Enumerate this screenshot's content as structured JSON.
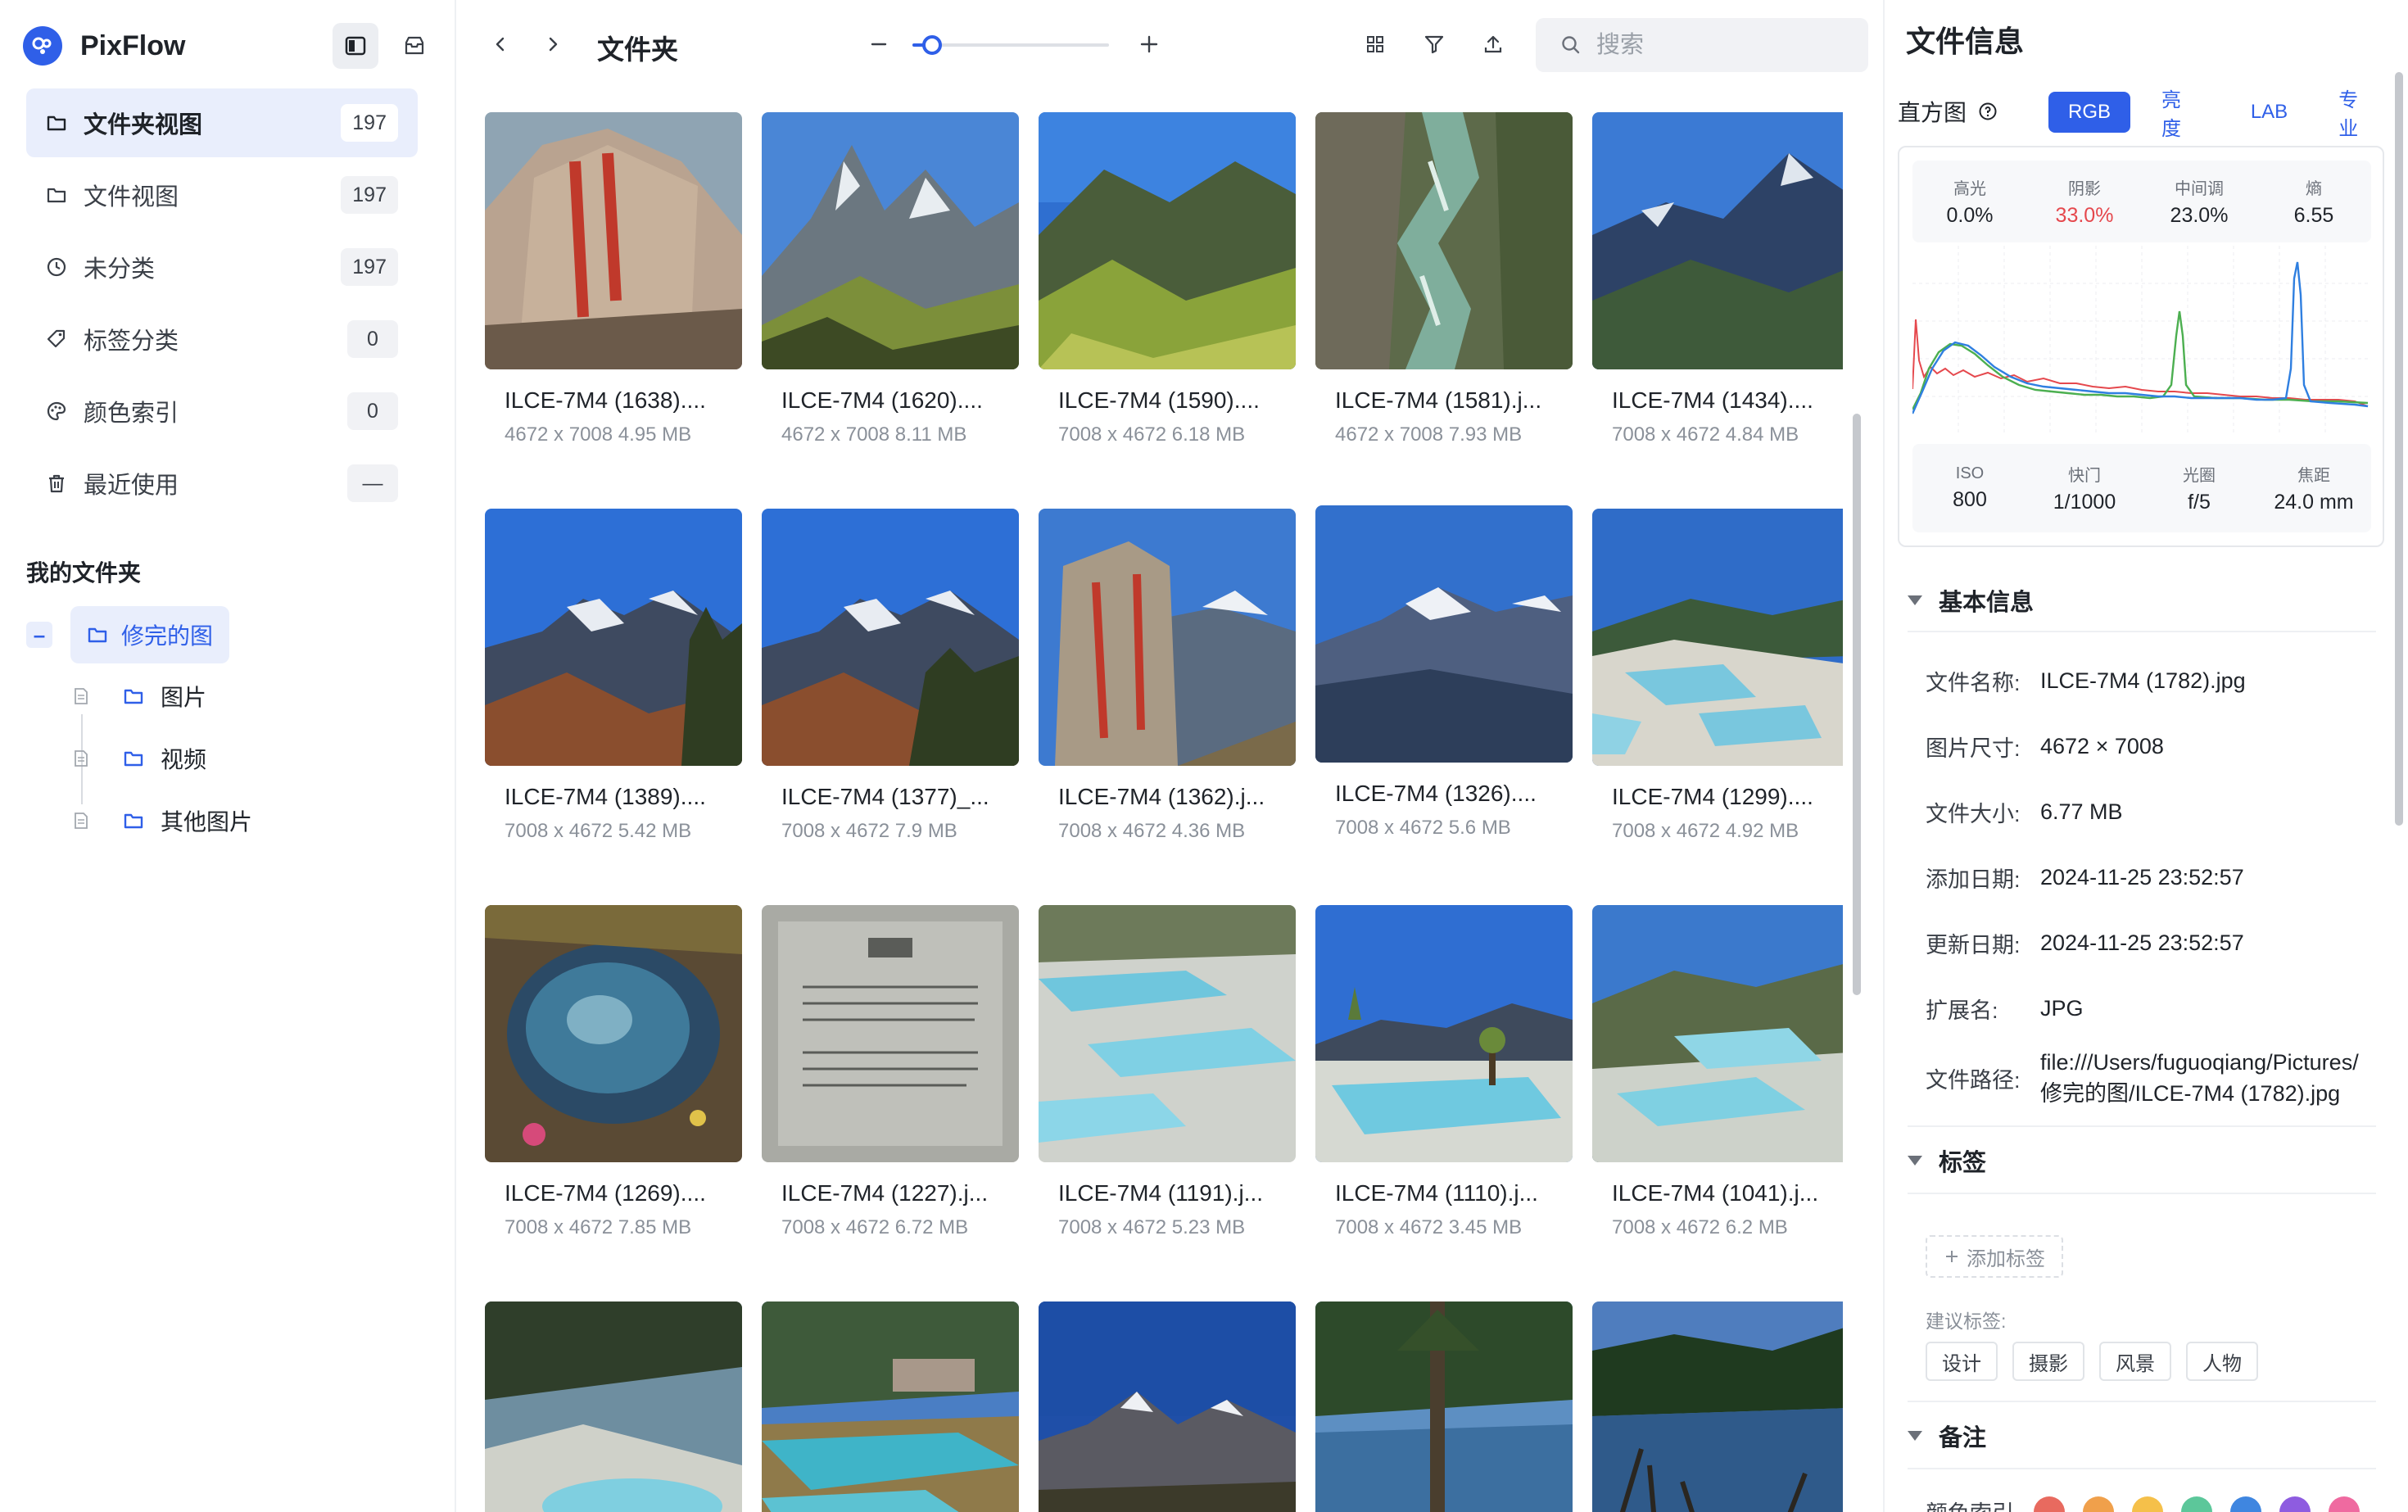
{
  "app": {
    "name": "PixFlow"
  },
  "sidebar": {
    "nav": [
      {
        "label": "文件夹视图",
        "count": "197"
      },
      {
        "label": "文件视图",
        "count": "197"
      },
      {
        "label": "未分类",
        "count": "197"
      },
      {
        "label": "标签分类",
        "count": "0"
      },
      {
        "label": "颜色索引",
        "count": "0"
      },
      {
        "label": "最近使用",
        "count": "—"
      }
    ],
    "my_folders": "我的文件夹",
    "tree_root": "修完的图",
    "tree_children": [
      "图片",
      "视频",
      "其他图片"
    ]
  },
  "toolbar": {
    "title": "文件夹",
    "zoom": 0.1,
    "search_placeholder": "搜索"
  },
  "grid": {
    "items": [
      {
        "name": "ILCE-7M4 (1638)....",
        "meta": "4672 x 7008 4.95 MB"
      },
      {
        "name": "ILCE-7M4 (1620)....",
        "meta": "4672 x 7008 8.11 MB"
      },
      {
        "name": "ILCE-7M4 (1590)....",
        "meta": "7008 x 4672 6.18 MB"
      },
      {
        "name": "ILCE-7M4 (1581).j...",
        "meta": "4672 x 7008 7.93 MB"
      },
      {
        "name": "ILCE-7M4 (1434)....",
        "meta": "7008 x 4672 4.84 MB"
      },
      {
        "name": "ILCE-7M4 (1389)....",
        "meta": "7008 x 4672 5.42 MB"
      },
      {
        "name": "ILCE-7M4 (1377)_...",
        "meta": "7008 x 4672 7.9 MB"
      },
      {
        "name": "ILCE-7M4 (1362).j...",
        "meta": "7008 x 4672 4.36 MB"
      },
      {
        "name": "ILCE-7M4 (1326)....",
        "meta": "7008 x 4672 5.6 MB"
      },
      {
        "name": "ILCE-7M4 (1299)....",
        "meta": "7008 x 4672 4.92 MB"
      },
      {
        "name": "ILCE-7M4 (1269)....",
        "meta": "7008 x 4672 7.85 MB"
      },
      {
        "name": "ILCE-7M4 (1227).j...",
        "meta": "7008 x 4672 6.72 MB"
      },
      {
        "name": "ILCE-7M4 (1191).j...",
        "meta": "7008 x 4672 5.23 MB"
      },
      {
        "name": "ILCE-7M4 (1110).j...",
        "meta": "7008 x 4672 3.45 MB"
      },
      {
        "name": "ILCE-7M4 (1041).j...",
        "meta": "7008 x 4672 6.2 MB"
      },
      {
        "name": "",
        "meta": ""
      },
      {
        "name": "",
        "meta": ""
      },
      {
        "name": "",
        "meta": ""
      },
      {
        "name": "",
        "meta": ""
      },
      {
        "name": "",
        "meta": ""
      }
    ]
  },
  "panel": {
    "title": "文件信息",
    "histogram": {
      "label": "直方图",
      "tabs": [
        "RGB",
        "亮度",
        "LAB",
        "专业"
      ],
      "active_tab": "RGB",
      "stats": [
        {
          "k": "高光",
          "v": "0.0%"
        },
        {
          "k": "阴影",
          "v": "33.0%"
        },
        {
          "k": "中间调",
          "v": "23.0%"
        },
        {
          "k": "熵",
          "v": "6.55"
        }
      ],
      "exif": [
        {
          "k": "ISO",
          "v": "800"
        },
        {
          "k": "快门",
          "v": "1/1000"
        },
        {
          "k": "光圈",
          "v": "f/5"
        },
        {
          "k": "焦距",
          "v": "24.0 mm"
        }
      ]
    },
    "basic": {
      "title": "基本信息",
      "rows": [
        {
          "k": "文件名称:",
          "v": "ILCE-7M4 (1782).jpg"
        },
        {
          "k": "图片尺寸:",
          "v": "4672 × 7008"
        },
        {
          "k": "文件大小:",
          "v": "6.77 MB"
        },
        {
          "k": "添加日期:",
          "v": "2024-11-25 23:52:57"
        },
        {
          "k": "更新日期:",
          "v": "2024-11-25 23:52:57"
        },
        {
          "k": "扩展名:",
          "v": "JPG"
        },
        {
          "k": "文件路径:",
          "v": "file:///Users/fuguoqiang/Pictures/修完的图/ILCE-7M4 (1782).jpg"
        }
      ]
    },
    "tags": {
      "title": "标签",
      "add_label": "添加标签",
      "suggest_label": "建议标签:",
      "suggested": [
        "设计",
        "摄影",
        "风景",
        "人物"
      ]
    },
    "notes": {
      "title": "备注",
      "color_label": "颜色索引",
      "colors": [
        "#e86a5f",
        "#f0a04b",
        "#f5c04a",
        "#5cc79a",
        "#3f86e0",
        "#8e5ce0",
        "#ef6aa0"
      ]
    }
  }
}
